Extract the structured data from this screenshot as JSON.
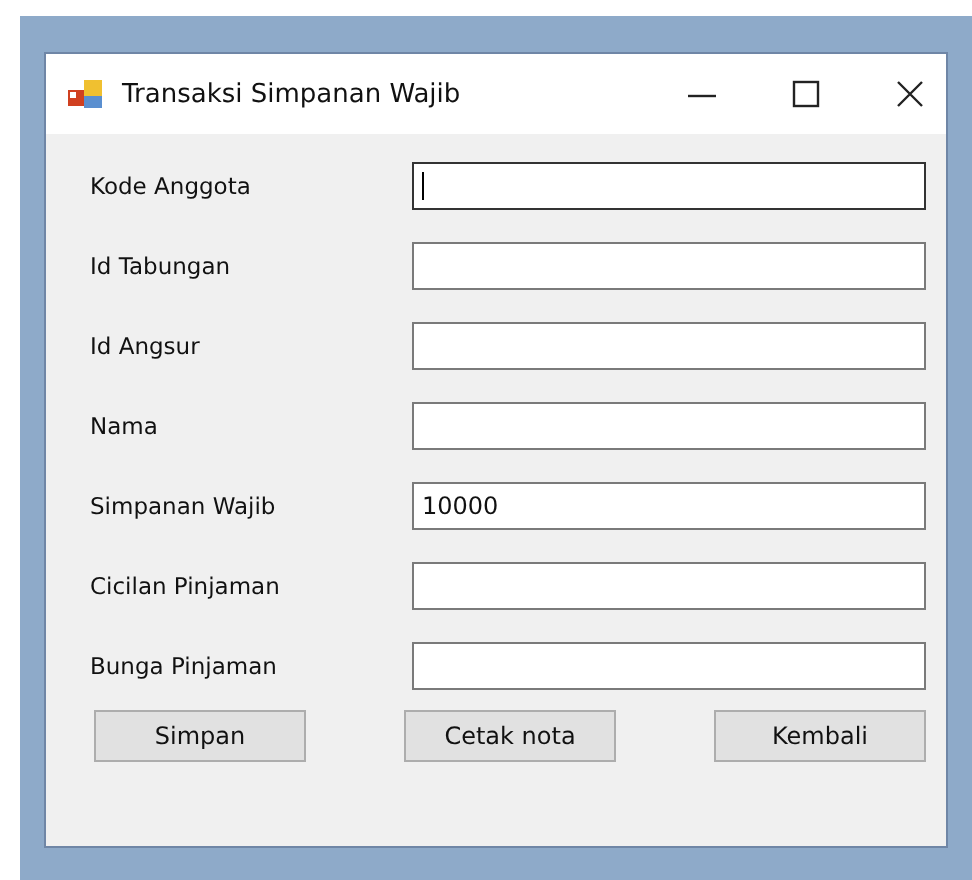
{
  "window": {
    "title": "Transaksi Simpanan Wajib"
  },
  "fields": [
    {
      "label": "Kode Anggota",
      "focused": true
    },
    {
      "label": "Id Tabungan",
      "focused": false
    },
    {
      "label": "Id Angsur",
      "focused": false
    },
    {
      "label": "Nama",
      "focused": false
    },
    {
      "label": "Simpanan Wajib",
      "value": "10000",
      "focused": false
    },
    {
      "label": "Cicilan Pinjaman",
      "focused": false
    },
    {
      "label": "Bunga Pinjaman",
      "focused": false
    }
  ],
  "buttons": [
    "Simpan",
    "Cetak nota",
    "Kembali"
  ]
}
